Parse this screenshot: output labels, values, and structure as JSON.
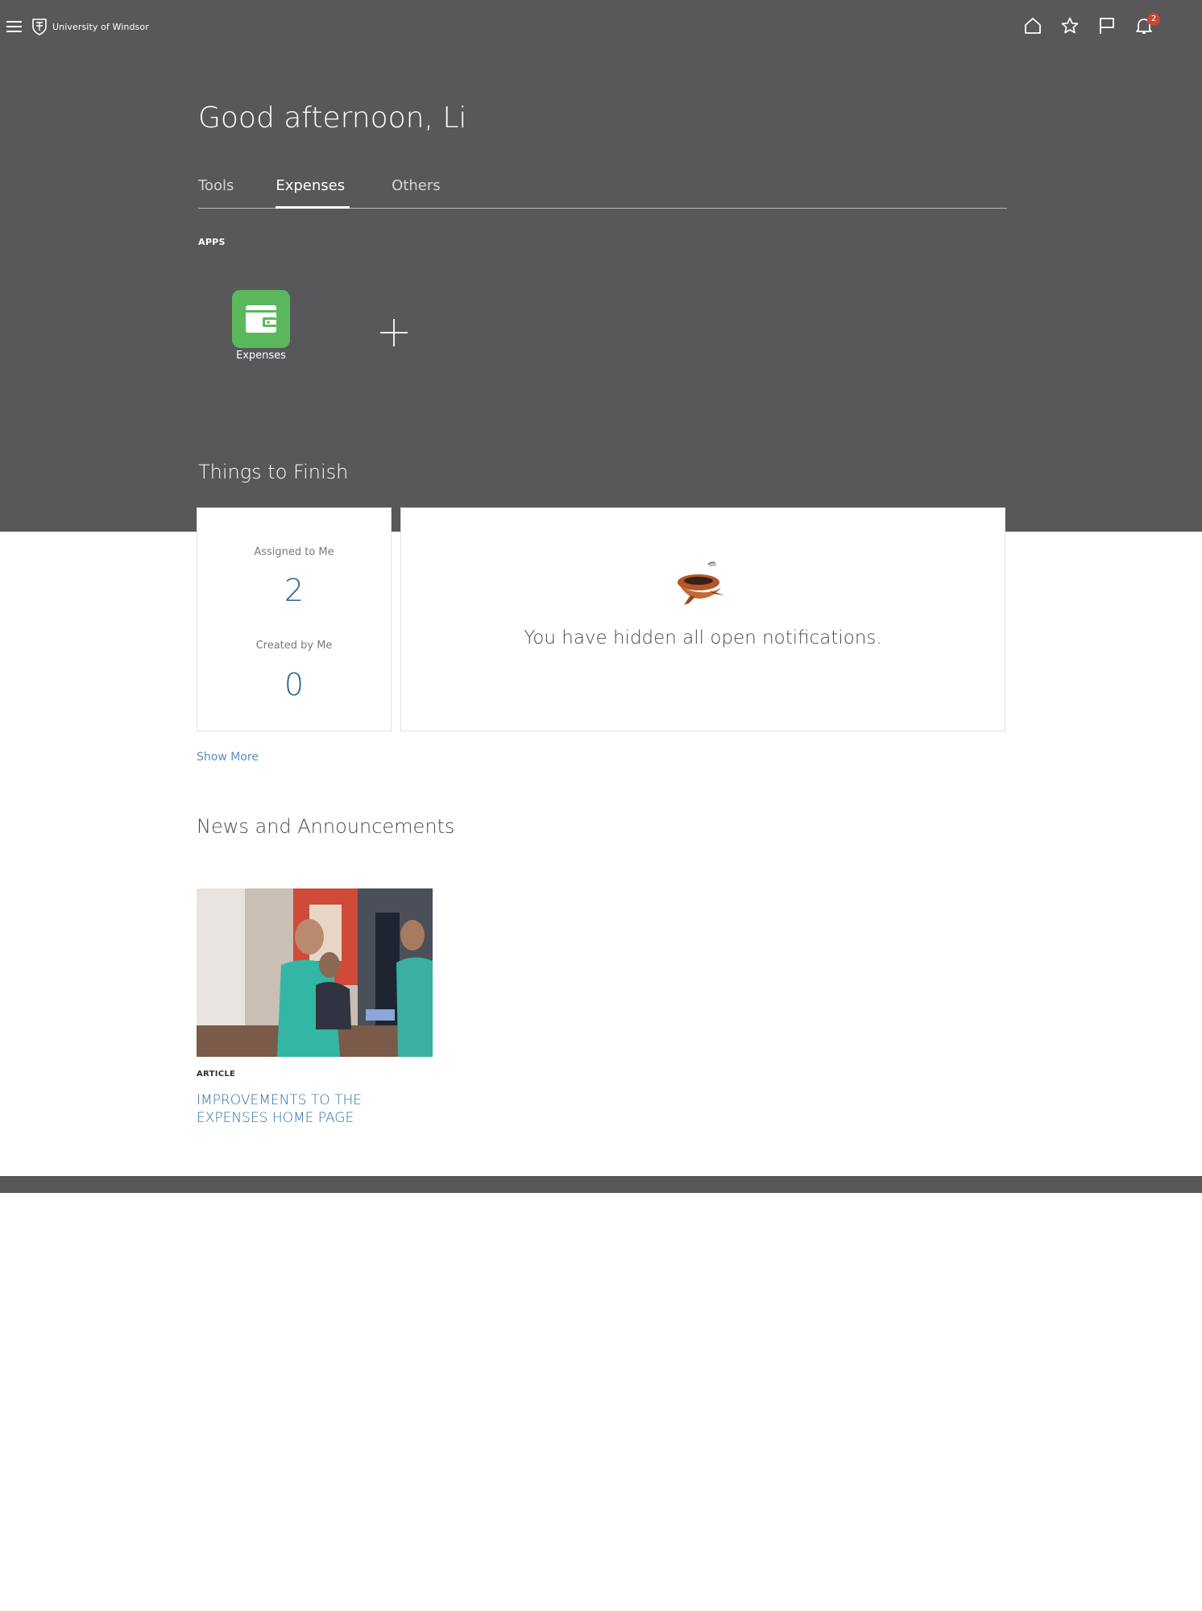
{
  "header": {
    "logo_text": "University of Windsor",
    "icons": [
      "hamburger-icon",
      "home-icon",
      "star-icon",
      "flag-icon",
      "bell-icon"
    ],
    "notification_count": "2"
  },
  "greeting": "Good afternoon, Li",
  "tabs": [
    {
      "label": "Tools",
      "active": false
    },
    {
      "label": "Expenses",
      "active": true
    },
    {
      "label": "Others",
      "active": false
    }
  ],
  "apps": {
    "label": "APPS",
    "items": [
      {
        "label": "Expenses",
        "icon": "wallet-icon",
        "color": "#5cb85c"
      }
    ]
  },
  "things_to_finish": {
    "title": "Things to Finish",
    "assigned_label": "Assigned to Me",
    "assigned_count": "2",
    "created_label": "Created by Me",
    "created_count": "0",
    "notification_message": "You have hidden all open notifications.",
    "show_more": "Show More"
  },
  "news": {
    "title": "News and Announcements",
    "articles": [
      {
        "type": "ARTICLE",
        "headline": "IMPROVEMENTS TO THE EXPENSES HOME PAGE"
      }
    ]
  },
  "colors": {
    "hero_bg": "#58585a",
    "link": "#2e6ea6",
    "badge": "#c74634"
  }
}
